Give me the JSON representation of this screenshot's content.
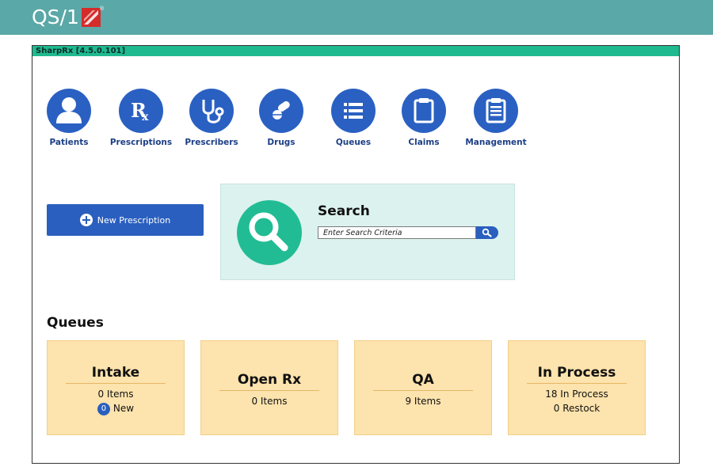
{
  "header": {
    "brand": "QS/1",
    "brand_mark": "®"
  },
  "app": {
    "title": "SharpRx  [4.5.0.101]"
  },
  "nav": {
    "items": [
      {
        "label": "Patients",
        "icon": "patient-icon"
      },
      {
        "label": "Prescriptions",
        "icon": "rx-icon"
      },
      {
        "label": "Prescribers",
        "icon": "stethoscope-icon"
      },
      {
        "label": "Drugs",
        "icon": "pills-icon"
      },
      {
        "label": "Queues",
        "icon": "list-icon"
      },
      {
        "label": "Claims",
        "icon": "clipboard-icon"
      },
      {
        "label": "Management",
        "icon": "checklist-clipboard-icon"
      }
    ]
  },
  "actions": {
    "new_prescription": "New Prescription"
  },
  "search": {
    "title": "Search",
    "placeholder": "Enter Search Criteria",
    "value": ""
  },
  "queues": {
    "title": "Queues",
    "cards": [
      {
        "title": "Intake",
        "line1": "0 Items",
        "badge": "0",
        "line2": "New"
      },
      {
        "title": "Open Rx",
        "line1": "0 Items"
      },
      {
        "title": "QA",
        "line1": "9 Items"
      },
      {
        "title": "In Process",
        "line1": "18 In Process",
        "line2": "0 Restock"
      }
    ]
  },
  "colors": {
    "topbar": "#5aa8a8",
    "app_bar": "#1fba8f",
    "nav_blue": "#2a60c2",
    "search_panel": "#dcf2ee",
    "search_green": "#22bc94",
    "queue_card": "#fde3ad",
    "logo_red": "#d42b2b"
  }
}
